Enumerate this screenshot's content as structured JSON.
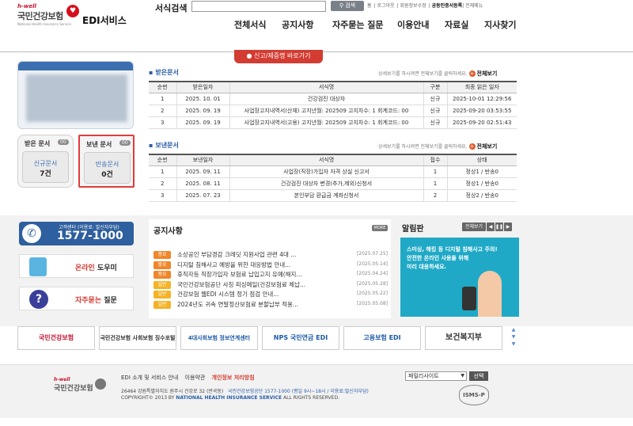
{
  "header": {
    "logo_top": "h-well",
    "logo_name": "국민건강보험",
    "logo_sub": "National Health Insurance Service",
    "service_title": "EDI서비스",
    "search_label": "서식검색",
    "search_placeholder": "",
    "search_button": "검색",
    "util_links": [
      "홈",
      "로그아웃",
      "회원정보수정",
      "공동인증서등록",
      "전체메뉴"
    ],
    "gnb": [
      "전체서식",
      "공지사항",
      "자주묻는 질문",
      "이용안내",
      "자료실",
      "지사찾기"
    ],
    "report_button": "신고/제증명 바로가기"
  },
  "left": {
    "received_box": {
      "title": "받은 문서",
      "badge": "00",
      "line1": "신규문서",
      "line2": "7건"
    },
    "sent_box": {
      "title": "보낸 문서",
      "badge": "00",
      "line1": "반송문서",
      "line2": "0건"
    }
  },
  "received": {
    "title": "받은문서",
    "note": "상세보기를 하시려면 전체보기를 클릭하세요.",
    "more": "전체보기",
    "columns": [
      "순번",
      "받은일자",
      "서식명",
      "구분",
      "최종 읽은 일자"
    ],
    "rows": [
      [
        "1",
        "2025. 10. 01",
        "건강검진 대상자",
        "신규",
        "2025-10-01 12:29:56"
      ],
      [
        "2",
        "2025. 09. 19",
        "사업장고지내역서(산재) 고지년월: 202509 고지차수: 1 회계코드: 00",
        "신규",
        "2025-09-20 03:53:55"
      ],
      [
        "3",
        "2025. 09. 19",
        "사업장고지내역서(고용) 고지년월: 202509 고지차수: 1 회계코드: 00",
        "신규",
        "2025-09-20 02:51:43"
      ]
    ]
  },
  "sent": {
    "title": "보낸문서",
    "note": "상세보기를 하시려면 전체보기를 클릭하세요.",
    "more": "전체보기",
    "columns": [
      "순번",
      "보낸일자",
      "서식명",
      "접수",
      "상태"
    ],
    "rows": [
      [
        "1",
        "2025. 09. 11",
        "사업장(직장)가입자 자격 상실 신고서",
        "1",
        "정상1 / 반송0"
      ],
      [
        "2",
        "2025. 08. 11",
        "건강검진 대상자 변경(추가,제외)신청서",
        "1",
        "정상1 / 반송0"
      ],
      [
        "3",
        "2025. 07. 23",
        "본인부담 환급금 계좌신청서",
        "2",
        "정상2 / 반송0"
      ]
    ]
  },
  "sidebar": {
    "call_label": "고객센터 (이용료: 발신자부담)",
    "call_number": "1577-1000",
    "online_help_em": "온라인",
    "online_help": "도우미",
    "faq_em": "자주묻는",
    "faq": "질문"
  },
  "notice": {
    "title": "공지사항",
    "more": "MORE",
    "items": [
      {
        "tag": "중요",
        "color": "#f0862a",
        "title": "소상공인 부담경감 크레딧 지원사업 관련 4대 ...",
        "date": "[2025.07.25]"
      },
      {
        "tag": "중요",
        "color": "#f0862a",
        "title": "디지털 침해사고 예방을 위한 대응방법 안내...",
        "date": "[2025.05.14]"
      },
      {
        "tag": "중요",
        "color": "#f0862a",
        "title": "휴직자등 직장가입자 보험료 납입고지 유예(해지...",
        "date": "[2025.04.24]"
      },
      {
        "tag": "일반",
        "color": "#f5b225",
        "title": "국민건강보험공단 사칭 피싱메일(건강보험료 체납...",
        "date": "[2025.05.28]"
      },
      {
        "tag": "일반",
        "color": "#f5b225",
        "title": "건강보험 웹EDI 시스템 정기 점검 안내...",
        "date": "[2025.05.22]"
      },
      {
        "tag": "일반",
        "color": "#f5b225",
        "title": "2024년도 귀속 연말정산보험료 분할납부 적용...",
        "date": "[2025.05.08]"
      }
    ]
  },
  "alarm": {
    "title": "알림판",
    "view_all": "전체보기",
    "banner_lines": [
      "스미싱, 해킹 등 디지털 침해사고 주의!",
      "안전한 온라인 사용을 위해",
      "미리 대응하세요."
    ]
  },
  "partners": [
    "국민건강보험",
    "국민건강보험 사회보험 징수포털",
    "4대사회보험 정보연계센터",
    "NPS 국민연금 EDI",
    "고용보험 EDI",
    "보건복지부"
  ],
  "footer": {
    "logo_top": "h-well",
    "logo_name": "국민건강보험",
    "links": [
      "EDI 소개 및 서비스 안내",
      "이용약관",
      "개인정보 처리방침"
    ],
    "address": "26464 강원특별자치도 원주시 건강로 32 (반곡동)",
    "phone": "국민건강보험공단 1577-1000 (평일 9시~18시 / 이용료:발신자부담)",
    "copyright_a": "COPYRIGHT© 2013 BY",
    "copyright_b": "NATIONAL HEALTH INSURANCE SERVICE",
    "copyright_c": "ALL RIGHTS RESERVED.",
    "family_site": "패밀리사이트",
    "select_button": "선택",
    "isms": "ISMS-P"
  }
}
